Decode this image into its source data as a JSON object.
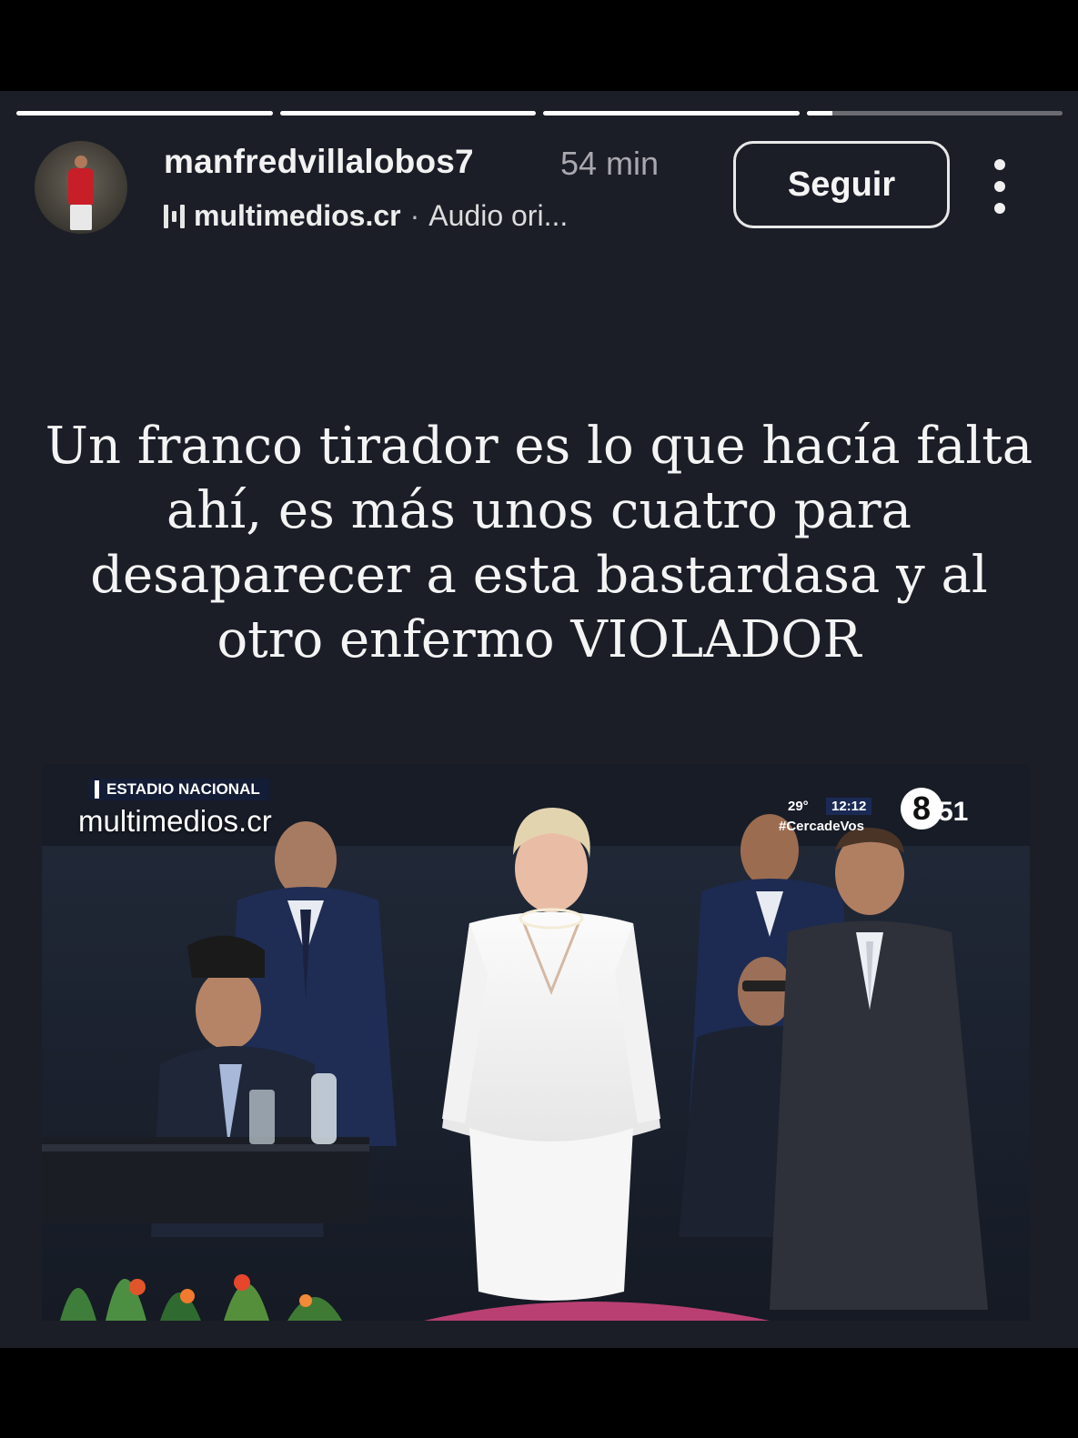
{
  "story": {
    "progress": [
      1,
      1,
      1,
      0.1
    ],
    "username": "manfredvillalobos7",
    "time": "54 min",
    "audio": {
      "icon": "audio-bars-icon",
      "source": "multimedios.cr",
      "separator": "·",
      "label": "Audio ori..."
    },
    "follow_label": "Seguir",
    "more_icon": "more-vertical-icon"
  },
  "caption": {
    "lines": [
      "Un franco tirador es lo que hacía falta",
      "ahí, es más unos cuatro para",
      "desaparecer a esta bastardasa y al",
      "otro enfermo VIOLADOR"
    ]
  },
  "media": {
    "location": "ESTADIO NACIONAL",
    "brand": "multimedios.cr",
    "temperature": "29°",
    "clock": "12:12",
    "hashtag": "#CercadeVos",
    "channel_mark": "8",
    "channel_count": "51"
  },
  "colors": {
    "background": "#000000",
    "story_bg": "#1b1e27",
    "text": "#f4f4f4",
    "muted": "#a8a8ae"
  }
}
